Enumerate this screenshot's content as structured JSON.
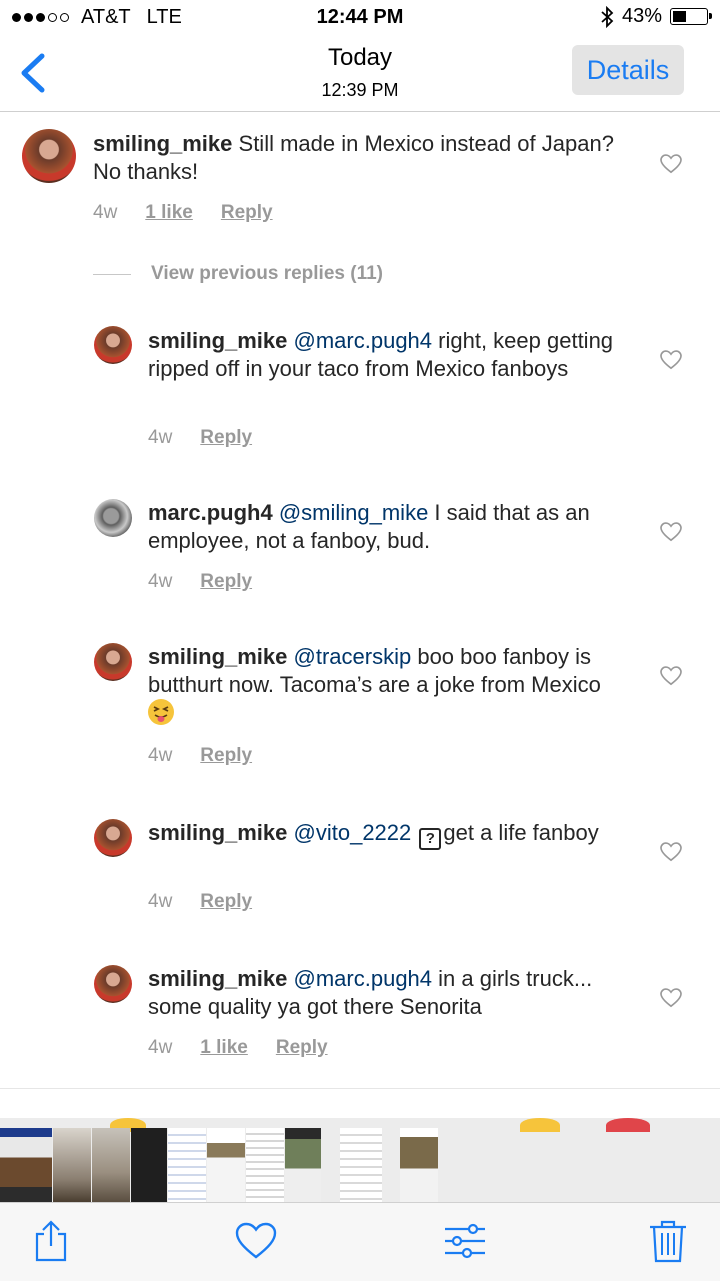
{
  "status_bar": {
    "carrier": "AT&T",
    "network": "LTE",
    "time": "12:44 PM",
    "battery": "43%",
    "battery_level": 0.43
  },
  "nav": {
    "title": "Today",
    "subtitle": "12:39 PM",
    "details_label": "Details"
  },
  "main_comment": {
    "username": "smiling_mike",
    "text": "Still made in Mexico instead of Japan? No thanks!",
    "age": "4w",
    "likes": "1 like",
    "reply": "Reply"
  },
  "view_previous": "View previous replies (11)",
  "replies": [
    {
      "username": "smiling_mike",
      "mention": "@marc.pugh4",
      "text": " right, keep getting ripped off in your taco from Mexico fanboys",
      "age": "4w",
      "reply": "Reply"
    },
    {
      "username": "marc.pugh4",
      "mention": "@smiling_mike",
      "text": " I said that as an employee, not a fanboy, bud.",
      "age": "4w",
      "reply": "Reply"
    },
    {
      "username": "smiling_mike",
      "mention": "@tracerskip",
      "text": " boo boo fanboy is butthurt now. Tacoma’s are a joke from Mexico",
      "age": "4w",
      "reply": "Reply"
    },
    {
      "username": "smiling_mike",
      "mention": "@vito_2222",
      "text": "get a life fanboy",
      "age": "4w",
      "reply": "Reply"
    },
    {
      "username": "smiling_mike",
      "mention": "@marc.pugh4",
      "text": " in a girls truck... some quality ya got there Senorita",
      "age": "4w",
      "likes": "1 like",
      "reply": "Reply"
    }
  ],
  "icons": {
    "back": "chevron-left-icon",
    "like": "heart-icon",
    "share": "share-icon",
    "favorite": "heart-icon",
    "adjust": "sliders-icon",
    "delete": "trash-icon"
  },
  "colors": {
    "accent": "#1a7cf2",
    "mention": "#003569",
    "meta": "#999999"
  }
}
